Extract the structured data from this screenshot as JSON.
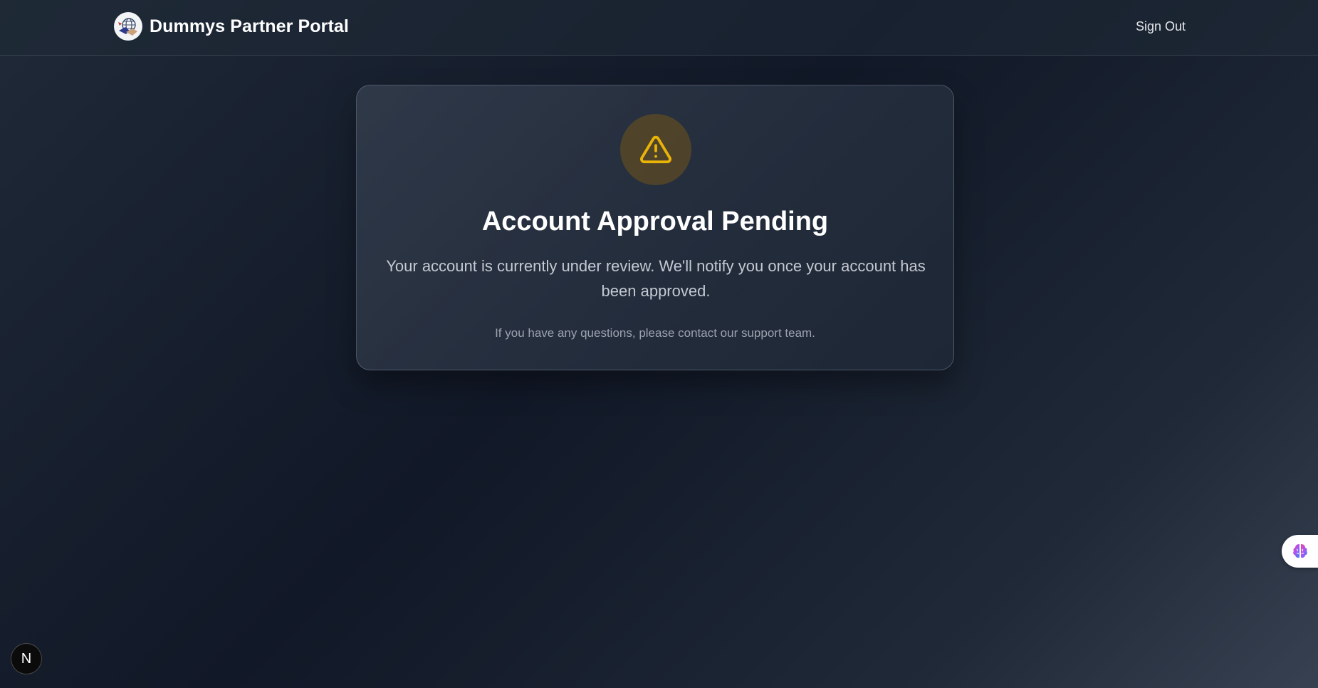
{
  "header": {
    "brand_title": "Dummys Partner Portal",
    "logo_icon": "globe-handshake-logo-icon",
    "sign_out_label": "Sign Out"
  },
  "notice": {
    "icon": "warning-triangle-icon",
    "title": "Account Approval Pending",
    "message": "Your account is currently under review. We'll notify you once your account has been approved.",
    "note": "If you have any questions, please contact our support team."
  },
  "overlays": {
    "dev_badge_label": "N",
    "assistant_widget_icon": "brain-icon"
  },
  "colors": {
    "accent_warning": "#eab308",
    "background_dark": "#111827",
    "card_bg": "#374151"
  }
}
